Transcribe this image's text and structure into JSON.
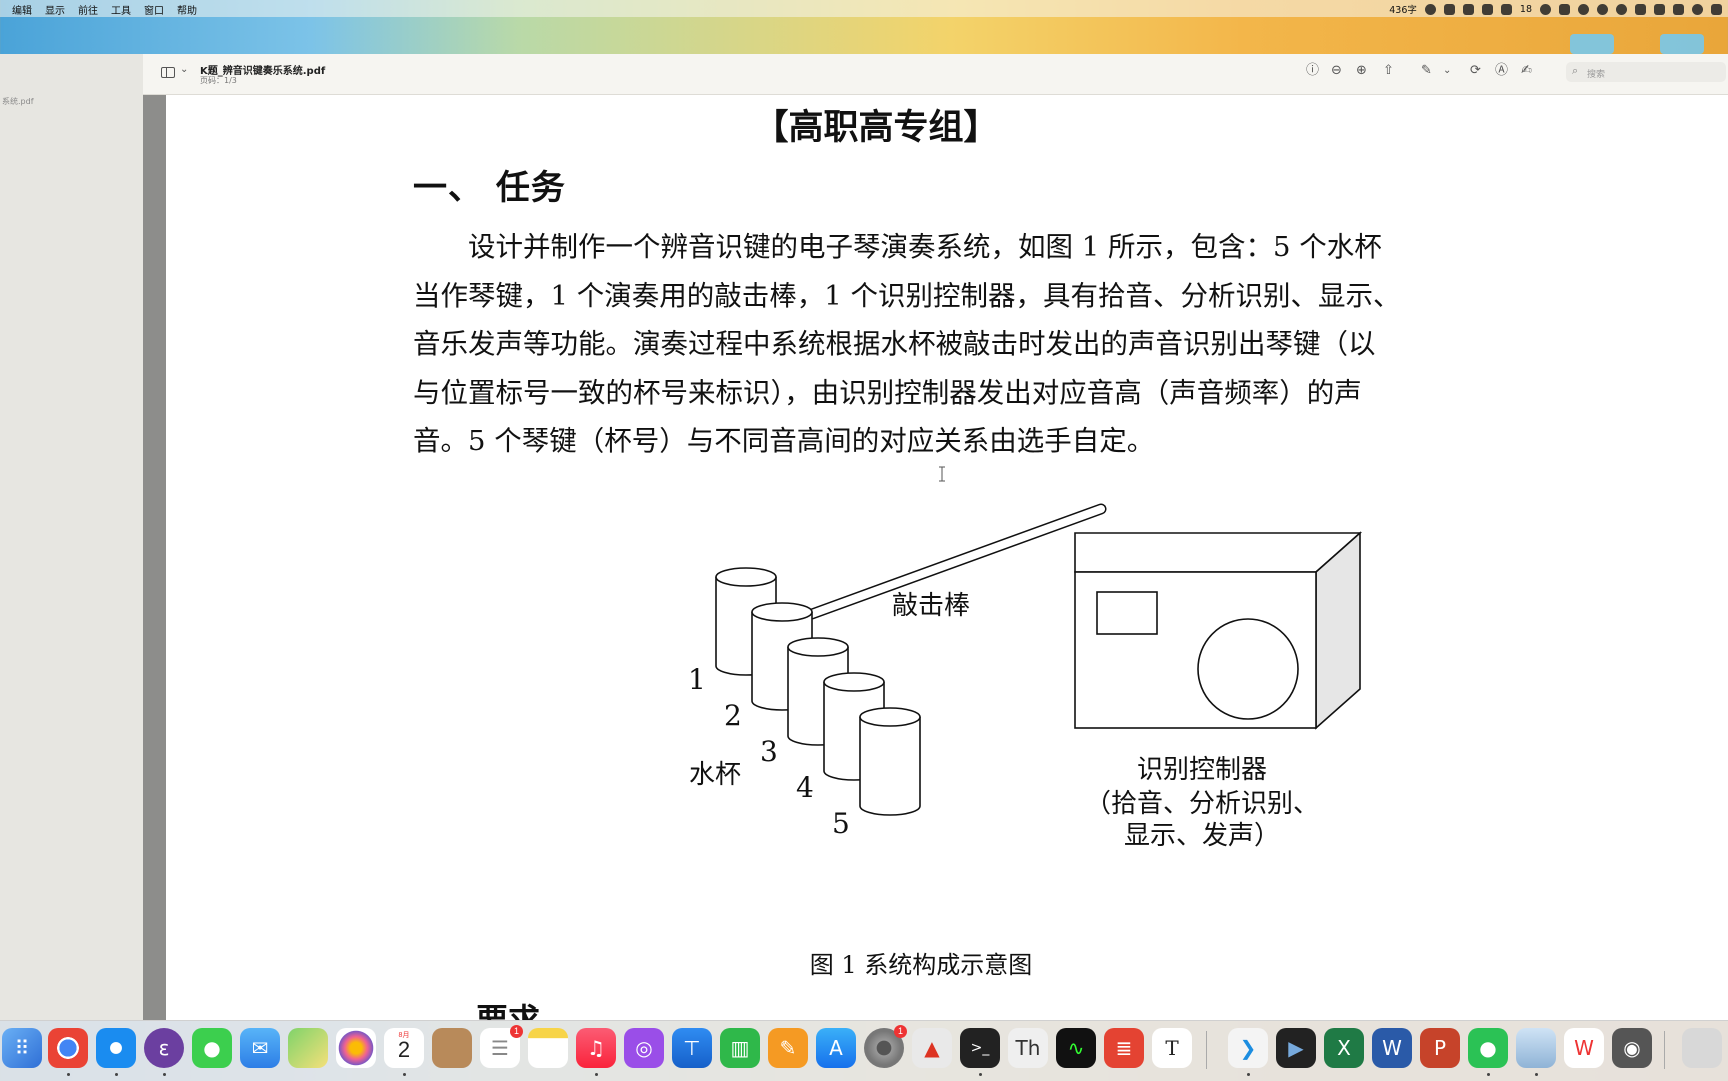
{
  "menubar": {
    "menus": [
      "编辑",
      "显示",
      "前往",
      "工具",
      "窗口",
      "帮助"
    ],
    "word_count": "436字",
    "wechat_count": "18",
    "status_icons": [
      "face-icon",
      "microphone-icon",
      "keyboard-icon",
      "screen-record-icon",
      "wechat-icon",
      "check-icon",
      "grid-icon",
      "bird-icon",
      "play-icon",
      "wifi-icon",
      "bluetooth-icon",
      "image-icon",
      "stack-icon",
      "search-icon",
      "control-center-icon"
    ]
  },
  "sidebar": {
    "thumbnail_label": "系统.pdf"
  },
  "toolbar": {
    "doc_title": "K题_辨音识键奏乐系统.pdf",
    "doc_subtitle": "页码：1/3",
    "search_placeholder": "搜索",
    "icons": [
      "info-icon",
      "zoom-out-icon",
      "zoom-in-icon",
      "share-icon",
      "markup-pen-icon",
      "rotate-icon",
      "annotate-icon",
      "signature-icon"
    ]
  },
  "document": {
    "title": "【高职高专组】",
    "section1": "一、 任务",
    "paragraph_lines": [
      "设计并制作一个辨音识键的电子琴演奏系统，如图 1 所示，包含：5 个水杯",
      "当作琴键，1 个演奏用的敲击棒，1 个识别控制器，具有拾音、分析识别、显示、",
      "音乐发声等功能。演奏过程中系统根据水杯被敲击时发出的声音识别出琴键（以",
      "与位置标号一致的杯号来标识），由识别控制器发出对应音高（声音频率）的声",
      "音。5 个琴键（杯号）与不同音高间的对应关系由选手自定。"
    ],
    "figure": {
      "stick_label": "敲击棒",
      "cups_label": "水杯",
      "cup_numbers": [
        "1",
        "2",
        "3",
        "4",
        "5"
      ],
      "controller_label_lines": [
        "识别控制器",
        "（拾音、分析识别、",
        "显示、发声）"
      ],
      "caption": "图 1 系统构成示意图"
    },
    "section2_partial": "要求"
  },
  "dock": {
    "apps": [
      "launchpad",
      "chrome",
      "safari",
      "emacs",
      "messages",
      "mail",
      "maps",
      "photos",
      "calendar",
      "contacts",
      "reminders",
      "notes",
      "music",
      "podcasts",
      "keynote",
      "numbers",
      "pages",
      "app-store",
      "system-settings",
      "acrobat",
      "terminal",
      "font-book",
      "activity-monitor",
      "todoist",
      "typora",
      "vscode",
      "final-cut",
      "excel",
      "word",
      "powerpoint",
      "wechat",
      "preview",
      "wps",
      "photo-booth",
      "downloads"
    ],
    "calendar_month": "8月",
    "calendar_day": "2",
    "reminders_badge": "1",
    "settings_badge": "1"
  }
}
